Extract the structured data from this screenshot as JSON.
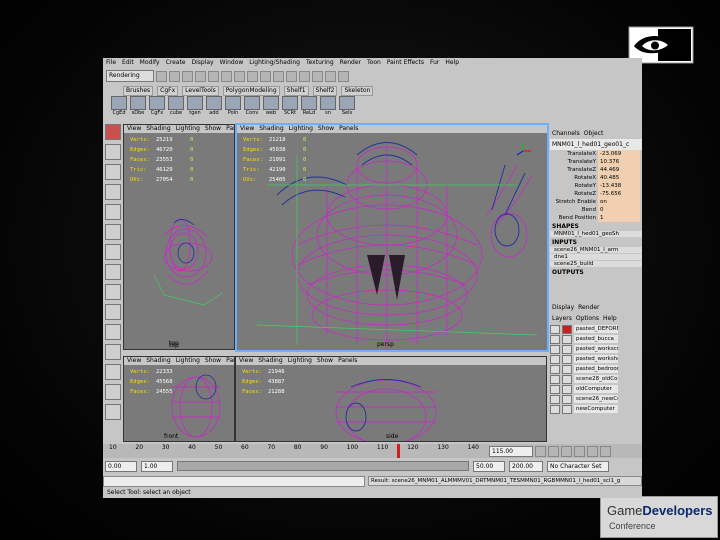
{
  "slide": {
    "logo": "nvidia-eye-logo"
  },
  "gdc": {
    "game": "Game",
    "developers": "Developers",
    "conference": "Conference"
  },
  "maya": {
    "menu": [
      "File",
      "Edit",
      "Modify",
      "Create",
      "Display",
      "Window",
      "Lighting/Shading",
      "Texturing",
      "Render",
      "Toon",
      "Paint Effects",
      "Fur",
      "Help"
    ],
    "mode": "Rendering",
    "shelf_tabs": [
      "Brushes",
      "CgFx",
      "LevelTools",
      "PolygonModeling",
      "Shelf1",
      "Shelf2",
      "Skeleton"
    ],
    "shelf_buttons": [
      "CgEd",
      "sDbe",
      "CgFx",
      "cube",
      "tgen",
      "add",
      "Poln",
      "Conv",
      "web",
      "SCRt",
      "ReLd",
      "sn",
      "Sels"
    ],
    "viewport_menu": [
      "View",
      "Shading",
      "Lighting",
      "Show",
      "Panels"
    ],
    "hud_labels": [
      "Verts:",
      "Edges:",
      "Faces:",
      "Tris:",
      "UVs:"
    ],
    "panels": {
      "top_left": {
        "values": [
          "25219",
          "46720",
          "23553",
          "46129",
          "27054"
        ],
        "label": "top"
      },
      "persp": {
        "values": [
          "21218",
          "45038",
          "21091",
          "42190",
          "25405"
        ],
        "label": "persp"
      },
      "bottom_left": {
        "values": [
          "22333",
          "45568",
          "24555"
        ],
        "label": "front"
      },
      "bottom_right": {
        "values": [
          "21946",
          "43887",
          "21288"
        ],
        "label": "side"
      }
    },
    "channel_box": {
      "tabs": [
        "Channels",
        "Object"
      ],
      "object": "MNM01_l_hed01_geo01_c",
      "attrs": [
        {
          "n": "TranslateX",
          "v": "-23.069"
        },
        {
          "n": "TranslateY",
          "v": "10.376"
        },
        {
          "n": "TranslateZ",
          "v": "44.469"
        },
        {
          "n": "RotateX",
          "v": "40.485"
        },
        {
          "n": "RotateY",
          "v": "-13.438"
        },
        {
          "n": "RotateZ",
          "v": "-75.656"
        },
        {
          "n": "Stretch Enable",
          "v": "on"
        },
        {
          "n": "Bend",
          "v": "0"
        },
        {
          "n": "Bend Position",
          "v": "1"
        }
      ],
      "shapes_title": "SHAPES",
      "shape": "MNM01_l_hed01_geoSh",
      "inputs_title": "INPUTS",
      "inputs": [
        "scene26_MNM01_l_arm",
        "dne1",
        "scene25_build"
      ],
      "outputs_title": "OUTPUTS"
    },
    "layers": {
      "tabs": [
        "Display",
        "Render"
      ],
      "menu": [
        "Layers",
        "Options",
        "Help"
      ],
      "rows": [
        "pasted_DEFORM",
        "pasted_bucca",
        "pasted_workscrp",
        "pasted_workshop",
        "pasted_bedroom",
        "scene28_oldComp",
        "oldComputer",
        "scene26_newComp",
        "newComputer"
      ]
    },
    "timeline": [
      "10",
      "20",
      "30",
      "40",
      "50",
      "60",
      "70",
      "80",
      "90",
      "100",
      "110",
      "120",
      "130",
      "140"
    ],
    "current_frame": "115.00",
    "range": {
      "start": "0.00",
      "start2": "1.00",
      "end": "50.00",
      "end2": "200.00",
      "char_set": "No Character Set"
    },
    "result": "Result: scene26_MNM01_ALMMMV01_DRTMNM01_TESMMN01_RGBMMN01_l_hed01_scl1_g",
    "help": "Select Tool: select an object"
  }
}
